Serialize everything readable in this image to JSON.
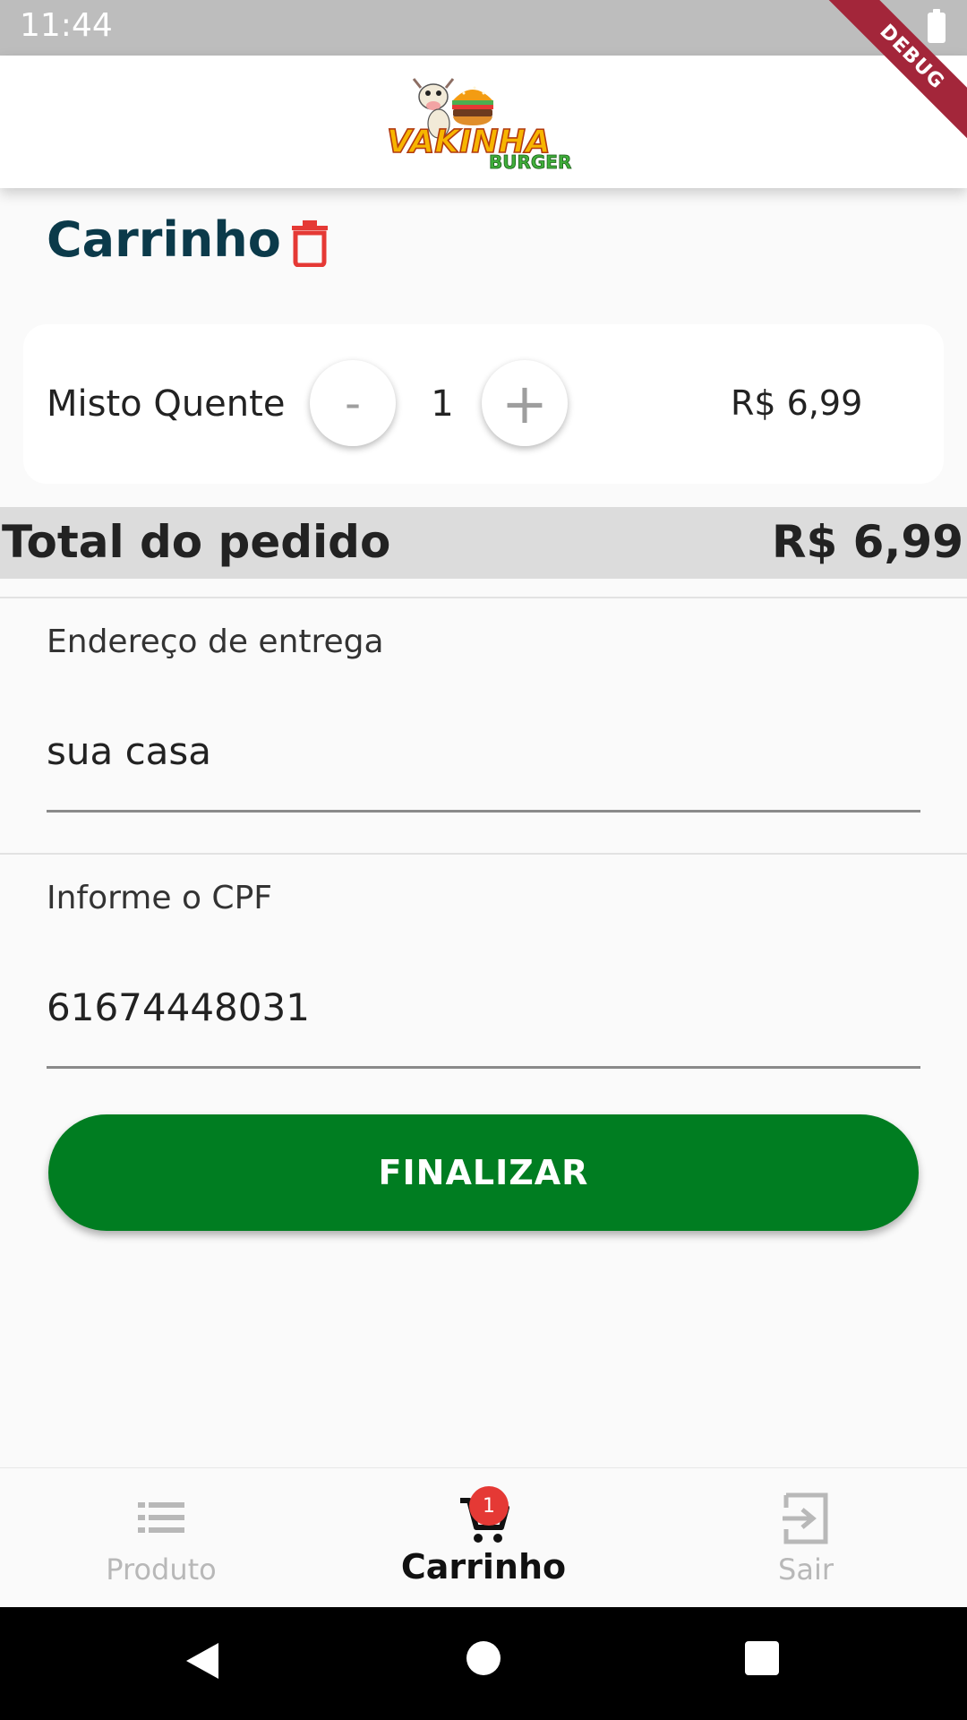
{
  "status_bar": {
    "time": "11:44",
    "battery_icon": "battery-icon"
  },
  "debug_banner": "DEBUG",
  "app_bar": {
    "logo_primary": "VAKINHA",
    "logo_secondary": "BURGER"
  },
  "cart": {
    "title": "Carrinho",
    "clear_icon": "trash-icon",
    "clear_color": "#e53935"
  },
  "items": [
    {
      "name": "Misto Quente",
      "quantity": "1",
      "minus_label": "-",
      "plus_label": "+",
      "price": "R$ 6,99"
    }
  ],
  "total": {
    "label": "Total do pedido",
    "value": "R$ 6,99"
  },
  "form": {
    "address_label": "Endereço de entrega",
    "address_value": "sua casa",
    "cpf_label": "Informe o CPF",
    "cpf_value": "61674448031"
  },
  "finalize_button": {
    "label": "FINALIZAR",
    "color": "#007d21"
  },
  "bottom_nav": {
    "items": [
      {
        "label": "Produto",
        "icon": "list-icon",
        "active": false
      },
      {
        "label": "Carrinho",
        "icon": "cart-icon",
        "active": true,
        "badge": "1"
      },
      {
        "label": "Sair",
        "icon": "exit-icon",
        "active": false
      }
    ]
  },
  "colors": {
    "title": "#0b3a4a",
    "badge": "#e53935",
    "inactive_nav": "#b8b8b8"
  }
}
